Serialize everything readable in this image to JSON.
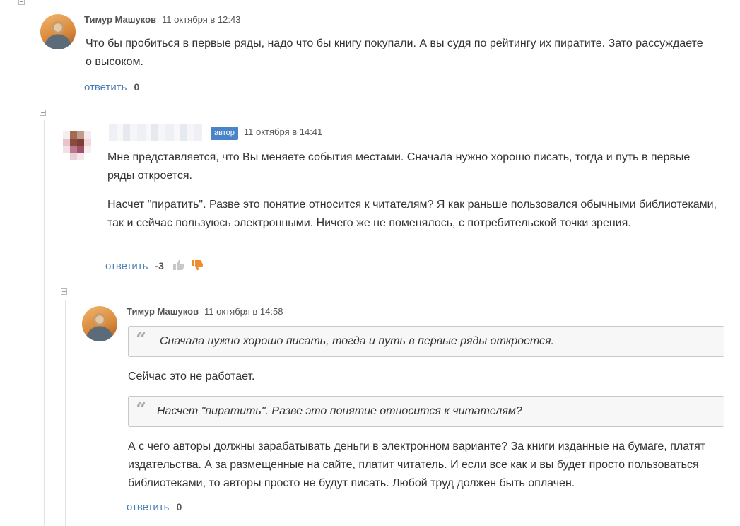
{
  "comments": [
    {
      "author": "Тимур Машуков",
      "date": "11 октября в 12:43",
      "paragraphs": [
        "Что бы пробиться в первые ряды, надо что бы книгу покупали. А вы судя по рейтингу их пиратите.  Зато рассуждаете о высоком."
      ],
      "reply_label": "ответить",
      "score": "0"
    },
    {
      "author": "",
      "badge": "автор",
      "date": "11 октября в 14:41",
      "paragraphs": [
        "Мне представляется, что Вы меняете события местами. Сначала нужно хорошо писать, тогда и путь  в первые ряды откроется.",
        "Насчет \"пиратить\". Разве это понятие относится к читателям? Я как раньше пользовался обычными библиотеками, так и сейчас пользуюсь электронными. Ничего же не поменялось, с потребительской точки зрения."
      ],
      "reply_label": "ответить",
      "score": "-3",
      "thumb_up_icon": "thumb-up-icon",
      "thumb_down_icon": "thumb-down-icon",
      "thumb_down_color": "#f08c2c",
      "thumb_up_color": "#c8c8c8"
    },
    {
      "author": "Тимур Машуков",
      "date": "11 октября в 14:58",
      "quote1": "Сначала нужно хорошо писать, тогда и путь  в первые ряды откроется.",
      "text1": "Сейчас это не работает.",
      "quote2": "Насчет \"пиратить\". Разве это понятие относится к читателям?",
      "text2": "А с чего авторы должны зарабатывать деньги в электронном варианте? За книги изданные на бумаге, платят издательства. А за размещенные на сайте, платит читатель. И если все как и вы будет просто пользоваться библиотеками, то авторы просто не будут писать. Любой труд должен быть оплачен.",
      "reply_label": "ответить",
      "score": "0"
    }
  ],
  "colors": {
    "link": "#4a7fb5",
    "badge": "#4a84c8",
    "quote_bg": "#f7f7f7"
  }
}
